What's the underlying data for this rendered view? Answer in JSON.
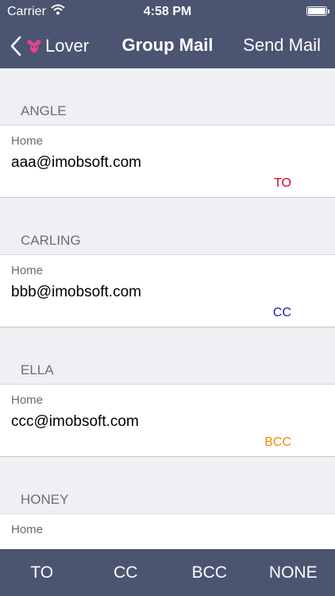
{
  "status_bar": {
    "carrier": "Carrier",
    "time": "4:58 PM"
  },
  "nav": {
    "back_label": "Lover",
    "title": "Group Mail",
    "action_label": "Send Mail"
  },
  "colors": {
    "bar": "#4b5471",
    "to": "#d0021b",
    "cc": "#1b1bb3",
    "bcc": "#f08c00"
  },
  "groups": [
    {
      "name": "ANGLE",
      "type": "Home",
      "email": "aaa@imobsoft.com",
      "tag": "TO"
    },
    {
      "name": "CARLING",
      "type": "Home",
      "email": "bbb@imobsoft.com",
      "tag": "CC"
    },
    {
      "name": "ELLA",
      "type": "Home",
      "email": "ccc@imobsoft.com",
      "tag": "BCC"
    },
    {
      "name": "HONEY",
      "type": "Home",
      "email": "",
      "tag": ""
    }
  ],
  "tabs": [
    "TO",
    "CC",
    "BCC",
    "NONE"
  ]
}
